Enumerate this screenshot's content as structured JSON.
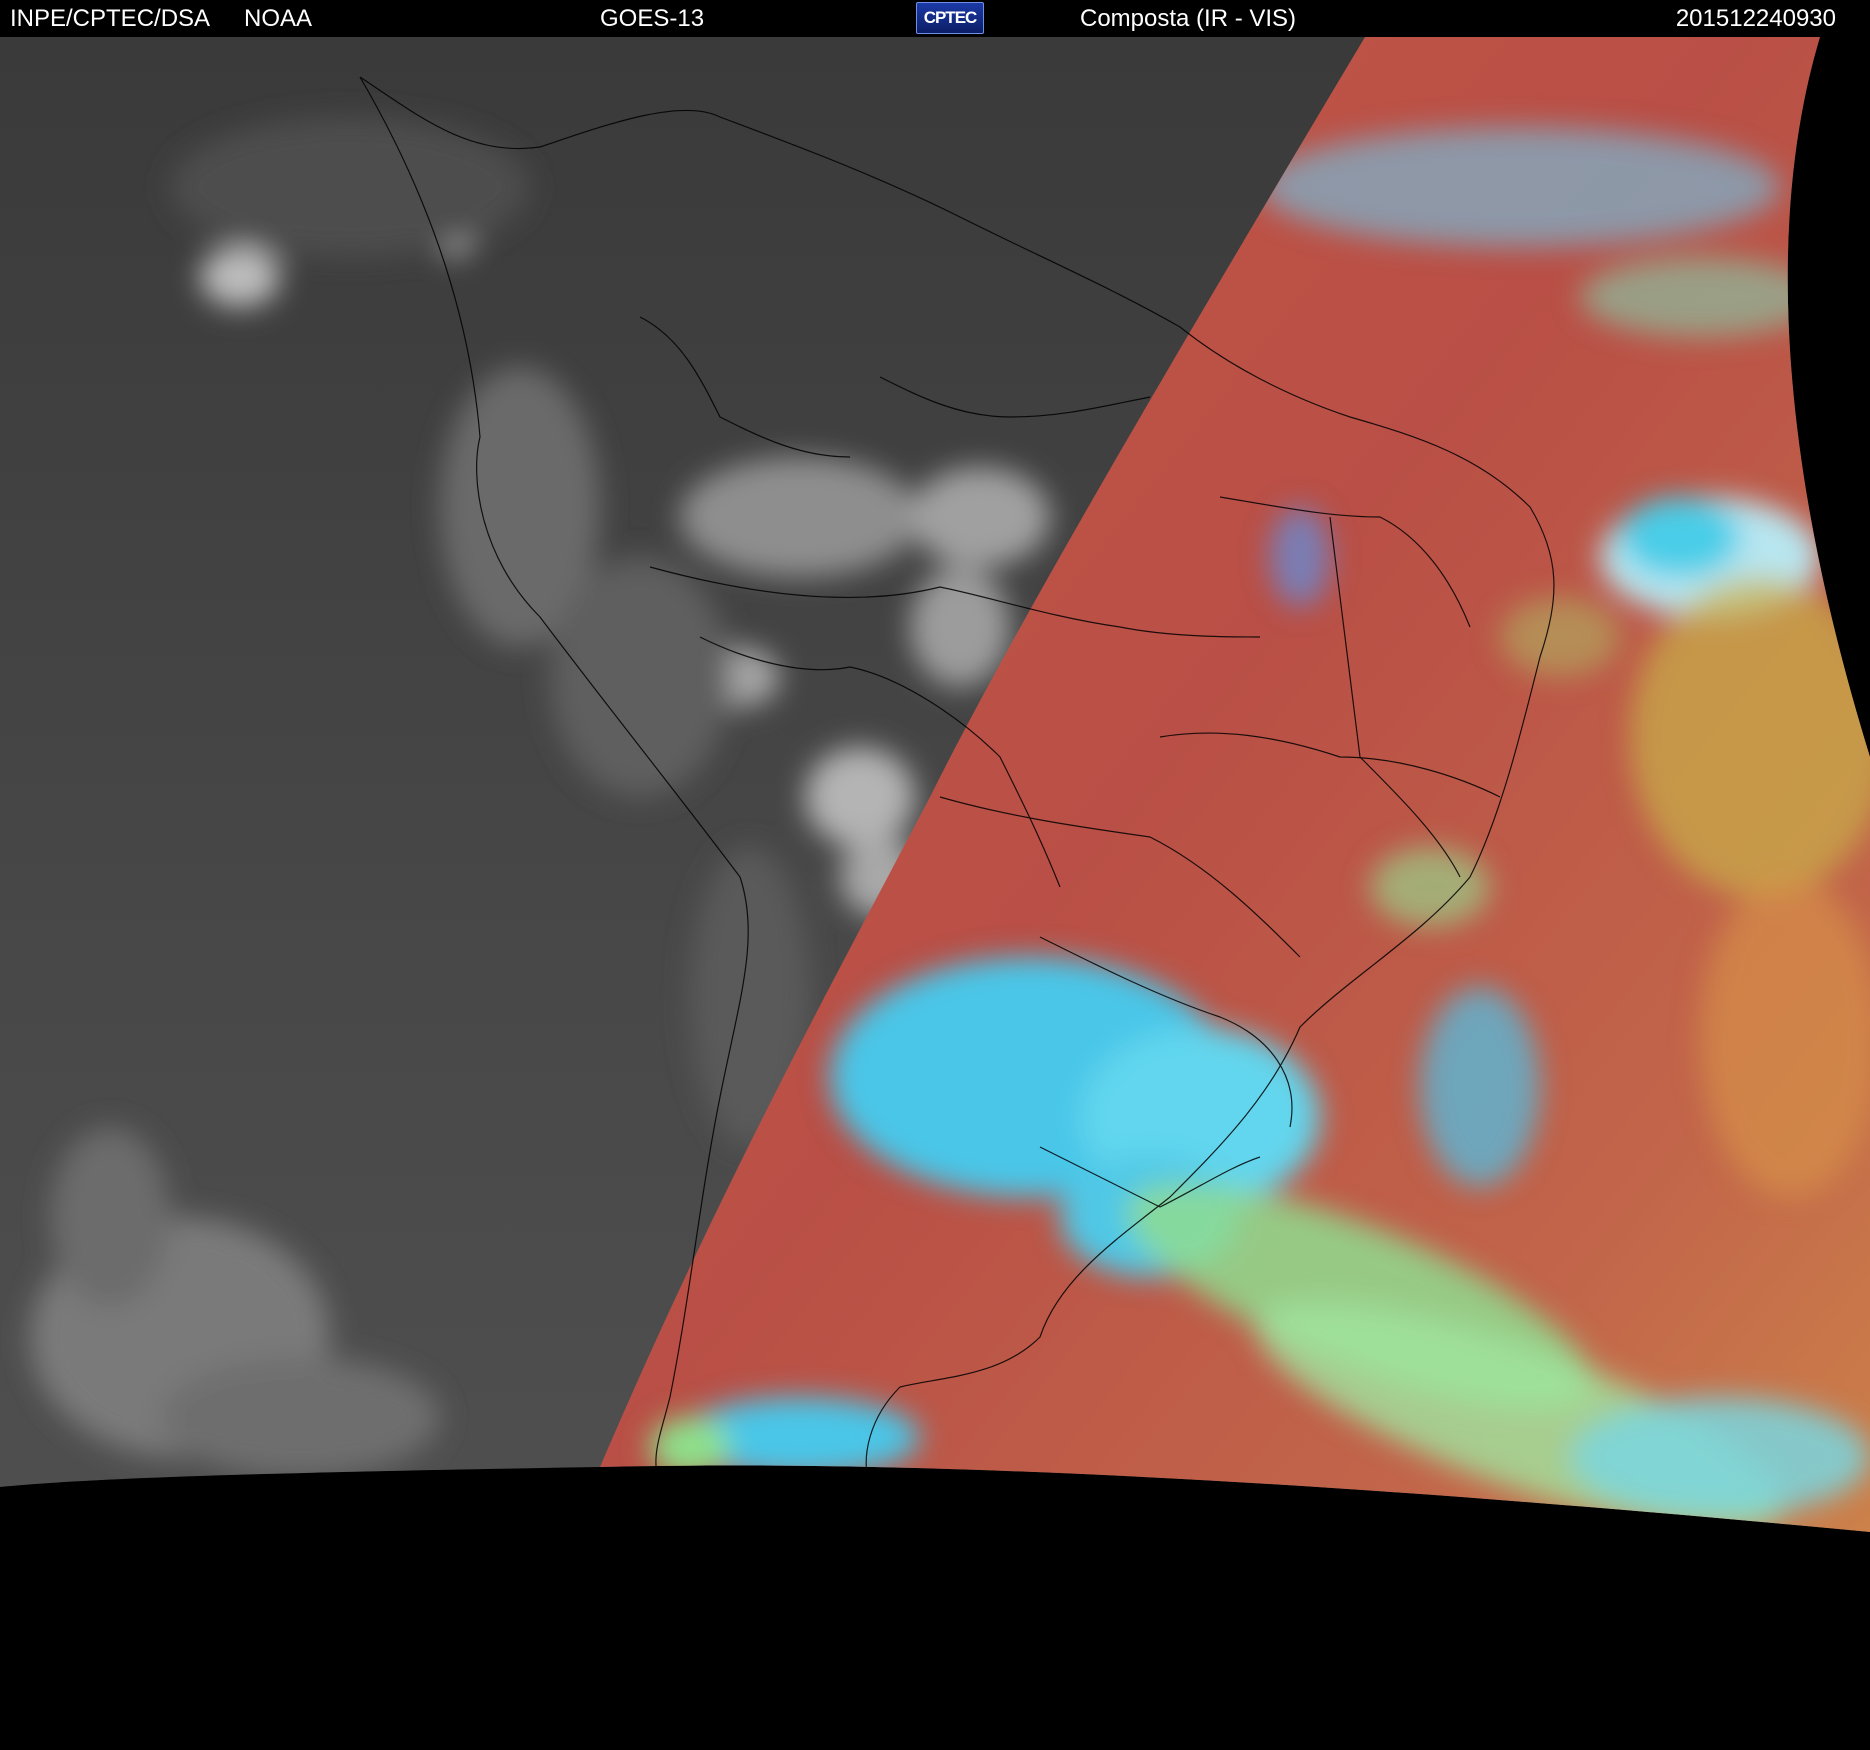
{
  "header": {
    "organization": "INPE/CPTEC/DSA",
    "agency": "NOAA",
    "satellite": "GOES-13",
    "logo_text": "CPTEC",
    "product": "Composta (IR - VIS)",
    "timestamp": "201512240930"
  },
  "colors": {
    "background": "#000000",
    "header_text": "#ffffff",
    "ir_gray": "#444444",
    "vis_red": "#b5524a",
    "vis_cyan": "#46c8e8",
    "vis_green": "#8ee08a",
    "vis_orange": "#d08a4a",
    "borders": "#000000"
  }
}
